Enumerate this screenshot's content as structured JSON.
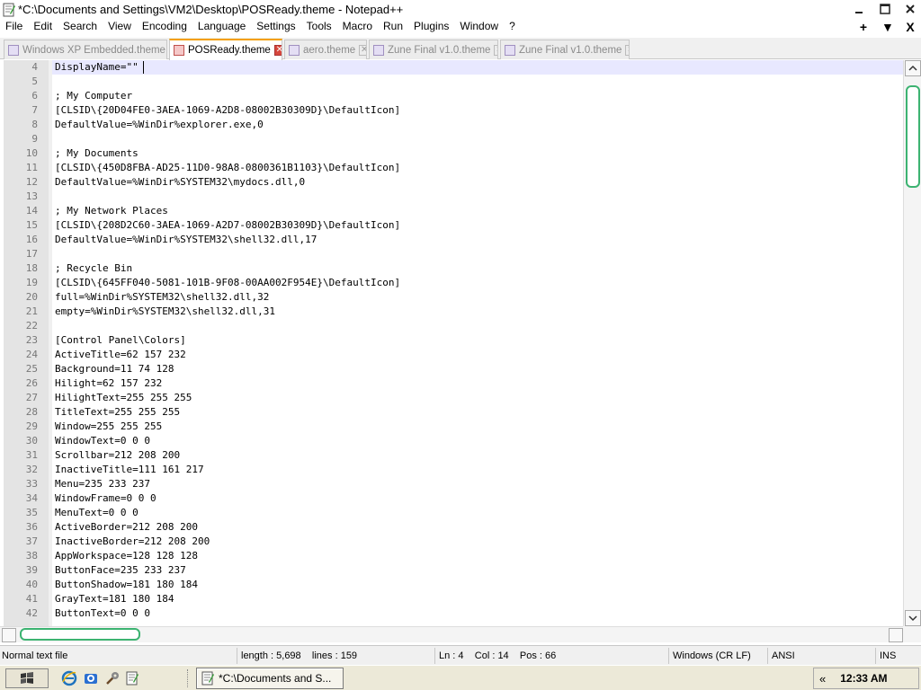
{
  "window": {
    "title": "*C:\\Documents and Settings\\VM2\\Desktop\\POSReady.theme - Notepad++"
  },
  "menu": {
    "items": [
      "File",
      "Edit",
      "Search",
      "View",
      "Encoding",
      "Language",
      "Settings",
      "Tools",
      "Macro",
      "Run",
      "Plugins",
      "Window",
      "?"
    ],
    "right": [
      "+",
      "▼",
      "X"
    ]
  },
  "tabs": [
    {
      "label": "Windows XP Embedded.theme",
      "active": false
    },
    {
      "label": "POSReady.theme",
      "active": true
    },
    {
      "label": "aero.theme",
      "active": false
    },
    {
      "label": "Zune Final v1.0.theme",
      "active": false
    },
    {
      "label": "Zune Final v1.0.theme",
      "active": false
    }
  ],
  "editor": {
    "current_line": 4,
    "lines": [
      {
        "n": "4",
        "text": "DisplayName=\"\""
      },
      {
        "n": "5",
        "text": ""
      },
      {
        "n": "6",
        "text": "; My Computer"
      },
      {
        "n": "7",
        "text": "[CLSID\\{20D04FE0-3AEA-1069-A2D8-08002B30309D}\\DefaultIcon]"
      },
      {
        "n": "8",
        "text": "DefaultValue=%WinDir%explorer.exe,0"
      },
      {
        "n": "9",
        "text": ""
      },
      {
        "n": "10",
        "text": "; My Documents"
      },
      {
        "n": "11",
        "text": "[CLSID\\{450D8FBA-AD25-11D0-98A8-0800361B1103}\\DefaultIcon]"
      },
      {
        "n": "12",
        "text": "DefaultValue=%WinDir%SYSTEM32\\mydocs.dll,0"
      },
      {
        "n": "13",
        "text": ""
      },
      {
        "n": "14",
        "text": "; My Network Places"
      },
      {
        "n": "15",
        "text": "[CLSID\\{208D2C60-3AEA-1069-A2D7-08002B30309D}\\DefaultIcon]"
      },
      {
        "n": "16",
        "text": "DefaultValue=%WinDir%SYSTEM32\\shell32.dll,17"
      },
      {
        "n": "17",
        "text": ""
      },
      {
        "n": "18",
        "text": "; Recycle Bin"
      },
      {
        "n": "19",
        "text": "[CLSID\\{645FF040-5081-101B-9F08-00AA002F954E}\\DefaultIcon]"
      },
      {
        "n": "20",
        "text": "full=%WinDir%SYSTEM32\\shell32.dll,32"
      },
      {
        "n": "21",
        "text": "empty=%WinDir%SYSTEM32\\shell32.dll,31"
      },
      {
        "n": "22",
        "text": ""
      },
      {
        "n": "23",
        "text": "[Control Panel\\Colors]"
      },
      {
        "n": "24",
        "text": "ActiveTitle=62 157 232"
      },
      {
        "n": "25",
        "text": "Background=11 74 128"
      },
      {
        "n": "26",
        "text": "Hilight=62 157 232"
      },
      {
        "n": "27",
        "text": "HilightText=255 255 255"
      },
      {
        "n": "28",
        "text": "TitleText=255 255 255"
      },
      {
        "n": "29",
        "text": "Window=255 255 255"
      },
      {
        "n": "30",
        "text": "WindowText=0 0 0"
      },
      {
        "n": "31",
        "text": "Scrollbar=212 208 200"
      },
      {
        "n": "32",
        "text": "InactiveTitle=111 161 217"
      },
      {
        "n": "33",
        "text": "Menu=235 233 237"
      },
      {
        "n": "34",
        "text": "WindowFrame=0 0 0"
      },
      {
        "n": "35",
        "text": "MenuText=0 0 0"
      },
      {
        "n": "36",
        "text": "ActiveBorder=212 208 200"
      },
      {
        "n": "37",
        "text": "InactiveBorder=212 208 200"
      },
      {
        "n": "38",
        "text": "AppWorkspace=128 128 128"
      },
      {
        "n": "39",
        "text": "ButtonFace=235 233 237"
      },
      {
        "n": "40",
        "text": "ButtonShadow=181 180 184"
      },
      {
        "n": "41",
        "text": "GrayText=181 180 184"
      },
      {
        "n": "42",
        "text": "ButtonText=0 0 0"
      }
    ]
  },
  "status": {
    "file_type": "Normal text file",
    "length": "length : 5,698",
    "lines": "lines : 159",
    "ln": "Ln : 4",
    "col": "Col : 14",
    "pos": "Pos : 66",
    "eol": "Windows (CR LF)",
    "encoding": "ANSI",
    "mode": "INS"
  },
  "taskbar": {
    "task_label": "*C:\\Documents and S...",
    "clock": "12:33 AM",
    "tray_expand": "«"
  },
  "colors": {
    "accent_tab": "#f4a000",
    "scroll_thumb": "#3cb371",
    "current_line_bg": "#e8e8ff"
  }
}
